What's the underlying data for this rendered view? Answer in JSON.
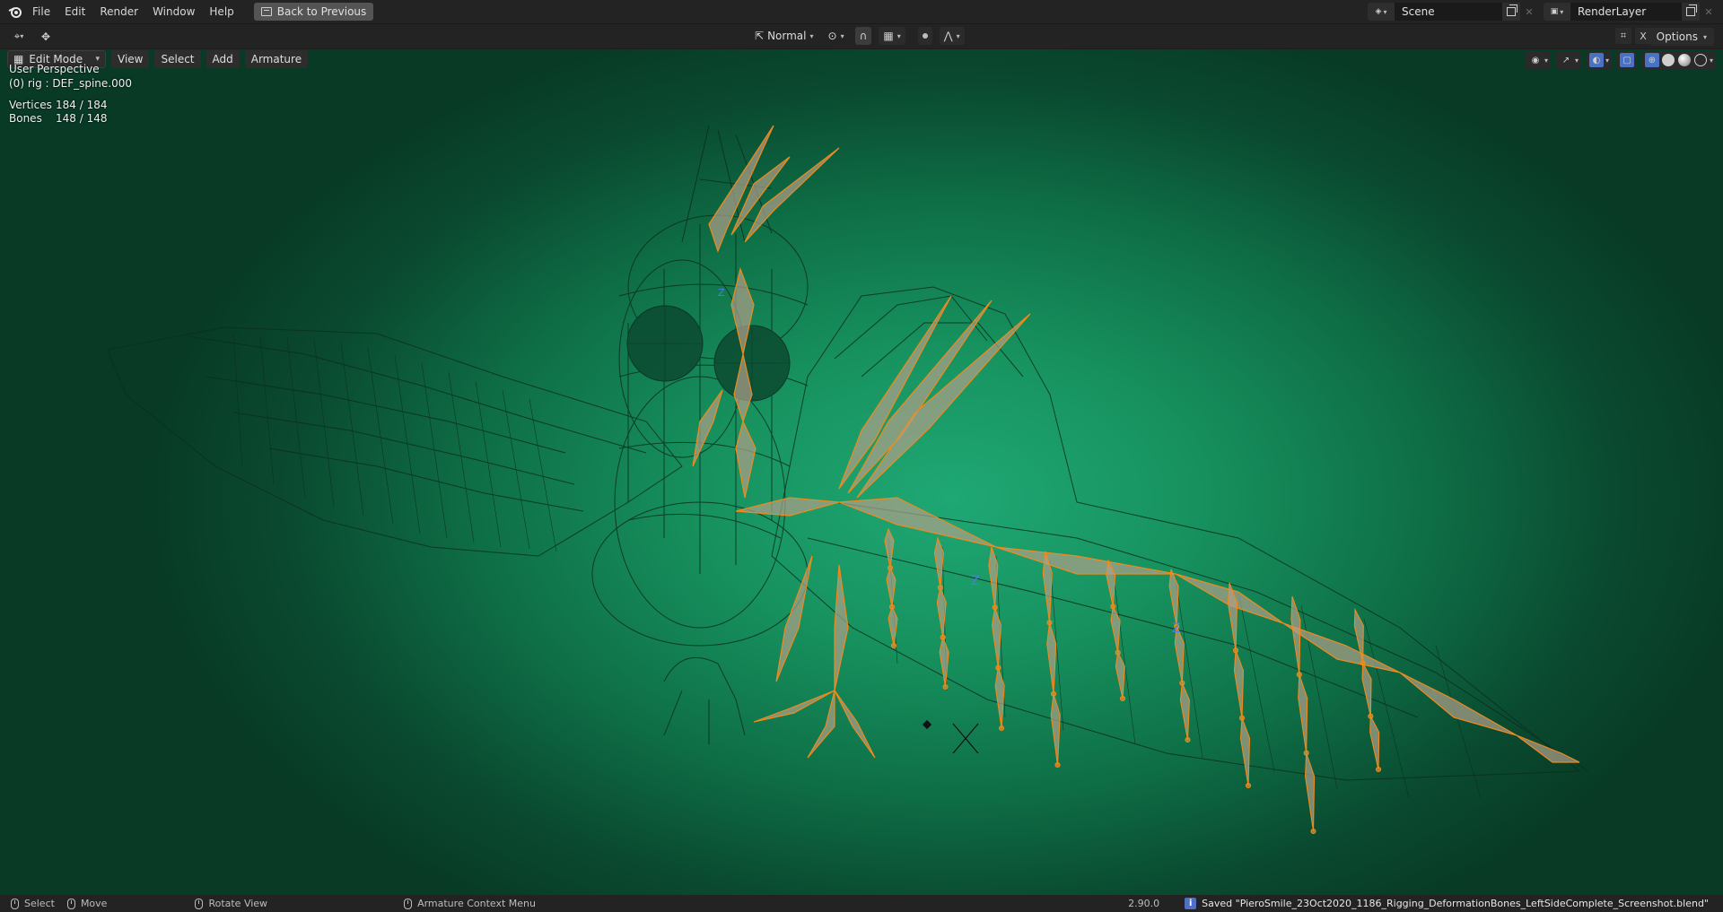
{
  "topbar": {
    "menus": [
      "File",
      "Edit",
      "Render",
      "Window",
      "Help"
    ],
    "back_button": "Back to Previous",
    "scene_name": "Scene",
    "view_layer": "RenderLayer"
  },
  "toolbar": {
    "orientation": "Normal",
    "options_label": "Options",
    "xray_label": "X"
  },
  "viewport": {
    "mode": "Edit Mode",
    "menus": [
      "View",
      "Select",
      "Add",
      "Armature"
    ],
    "perspective": "User Perspective",
    "active_object": "(0) rig : DEF_spine.000",
    "stats": {
      "vertices_label": "Vertices",
      "vertices_value": "184 / 184",
      "bones_label": "Bones",
      "bones_value": "148 / 148"
    },
    "colors": {
      "bg_center": "#1fa874",
      "bg_edge": "#083a26",
      "wire": "#0b2f1f",
      "bone_fill": "#b09f8a",
      "bone_outline": "#f08a1c"
    }
  },
  "statusbar": {
    "select": "Select",
    "move": "Move",
    "rotate": "Rotate View",
    "context_menu": "Armature Context Menu",
    "version": "2.90.0",
    "message": "Saved \"PieroSmile_23Oct2020_1186_Rigging_DeformationBones_LeftSideComplete_Screenshot.blend\""
  }
}
